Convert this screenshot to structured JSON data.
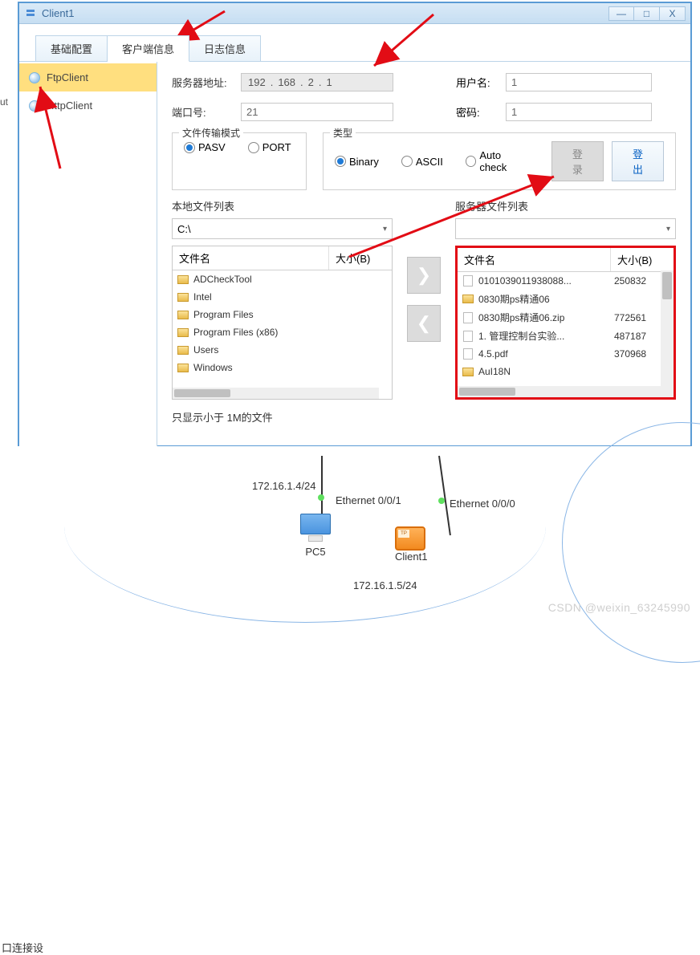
{
  "window": {
    "title": "Client1",
    "min": "—",
    "max": "□",
    "close": "X"
  },
  "tabs": [
    "基础配置",
    "客户端信息",
    "日志信息"
  ],
  "active_tab": 1,
  "sidebar": {
    "items": [
      {
        "label": "FtpClient"
      },
      {
        "label": "HttpClient"
      }
    ],
    "active": 0
  },
  "form": {
    "server_label": "服务器地址:",
    "ip": {
      "a": "192",
      "b": "168",
      "c": "2",
      "d": "1",
      "sep": "."
    },
    "user_label": "用户名:",
    "user_value": "1",
    "port_label": "端口号:",
    "port_value": "21",
    "pass_label": "密码:",
    "pass_value": "1"
  },
  "transfer_mode": {
    "legend": "文件传输模式",
    "options": [
      {
        "label": "PASV",
        "checked": true
      },
      {
        "label": "PORT",
        "checked": false
      }
    ]
  },
  "type_mode": {
    "legend": "类型",
    "options": [
      {
        "label": "Binary",
        "checked": true
      },
      {
        "label": "ASCII",
        "checked": false
      },
      {
        "label": "Auto check",
        "checked": false
      }
    ]
  },
  "buttons": {
    "login": "登录",
    "logout": "登出"
  },
  "local": {
    "title": "本地文件列表",
    "path": "C:\\",
    "col_name": "文件名",
    "col_size": "大小(B)",
    "rows": [
      {
        "name": "ADCheckTool",
        "size": "",
        "type": "folder"
      },
      {
        "name": "Intel",
        "size": "",
        "type": "folder"
      },
      {
        "name": "Program Files",
        "size": "",
        "type": "folder"
      },
      {
        "name": "Program Files (x86)",
        "size": "",
        "type": "folder"
      },
      {
        "name": "Users",
        "size": "",
        "type": "folder"
      },
      {
        "name": "Windows",
        "size": "",
        "type": "folder"
      }
    ]
  },
  "remote": {
    "title": "服务器文件列表",
    "path": "",
    "col_name": "文件名",
    "col_size": "大小(B)",
    "rows": [
      {
        "name": "0101039011938088...",
        "size": "250832",
        "type": "file"
      },
      {
        "name": "0830期ps精通06",
        "size": "",
        "type": "folder"
      },
      {
        "name": "0830期ps精通06.zip",
        "size": "772561",
        "type": "file"
      },
      {
        "name": "1. 管理控制台实验...",
        "size": "487187",
        "type": "file"
      },
      {
        "name": "4.5.pdf",
        "size": "370968",
        "type": "file"
      },
      {
        "name": "AuI18N",
        "size": "",
        "type": "folder"
      }
    ]
  },
  "transfer_btns": {
    "right": "❯",
    "left": "❮"
  },
  "foot_note": "只显示小于 1M的文件",
  "left_cut": "ut",
  "left_cut2": "口连接设",
  "network": {
    "ip_pc5": "172.16.1.4/24",
    "eth0": "Ethernet 0/0/1",
    "eth1": "Ethernet 0/0/0",
    "pc5": "PC5",
    "client1": "Client1",
    "ip_client1": "172.16.1.5/24"
  },
  "watermark": "CSDN @weixin_63245990"
}
